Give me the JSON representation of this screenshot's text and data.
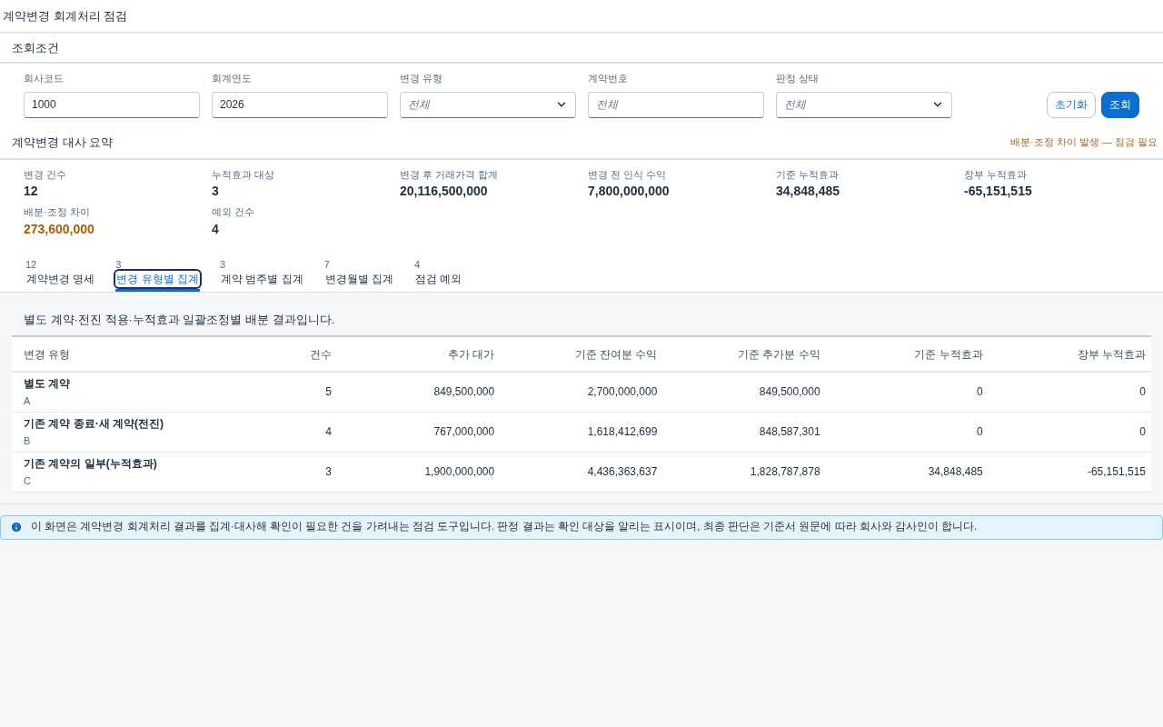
{
  "page_title": "계약변경 회계처리 점검",
  "filter": {
    "title": "조회조건",
    "fields": [
      {
        "label": "회사코드",
        "kind": "input",
        "value": "1000"
      },
      {
        "label": "회계연도",
        "kind": "input",
        "value": "2026"
      },
      {
        "label": "변경 유형",
        "kind": "select",
        "placeholder": "전체"
      },
      {
        "label": "계약번호",
        "kind": "input",
        "placeholder": "전체"
      },
      {
        "label": "판정 상태",
        "kind": "select",
        "placeholder": "전체"
      }
    ],
    "buttons": [
      {
        "label": "초기화",
        "kind": "secondary"
      },
      {
        "label": "조회",
        "kind": "primary"
      }
    ]
  },
  "summary": {
    "title": "계약변경 대사 요약",
    "alert": "배분·조정 차이 발생 — 점검 필요",
    "kpis": [
      {
        "label": "변경 건수",
        "value": "12",
        "kind": "normal"
      },
      {
        "label": "누적효과 대상",
        "value": "3",
        "kind": "normal"
      },
      {
        "label": "변경 후 거래가격 합계",
        "value": "20,116,500,000",
        "kind": "normal"
      },
      {
        "label": "변경 전 인식 수익",
        "value": "7,800,000,000",
        "kind": "normal"
      },
      {
        "label": "기준 누적효과",
        "value": "34,848,485",
        "kind": "normal"
      },
      {
        "label": "장부 누적효과",
        "value": "-65,151,515",
        "kind": "normal"
      },
      {
        "label": "배분·조정 차이",
        "value": "273,600,000",
        "kind": "warning"
      },
      {
        "label": "예외 건수",
        "value": "4",
        "kind": "normal"
      }
    ]
  },
  "tabs": [
    {
      "count": "12",
      "label": "계약변경 명세",
      "selected": false
    },
    {
      "count": "3",
      "label": "변경 유형별 집계",
      "selected": true
    },
    {
      "count": "3",
      "label": "계약 범주별 집계",
      "selected": false
    },
    {
      "count": "7",
      "label": "변경월별 집계",
      "selected": false
    },
    {
      "count": "4",
      "label": "점검 예외",
      "selected": false
    }
  ],
  "table": {
    "caption": "별도 계약·전진 적용·누적효과 일괄조정별 배분 결과입니다.",
    "columns": [
      "변경 유형",
      "건수",
      "추가 대가",
      "기준 잔여분 수익",
      "기준 추가분 수익",
      "기준 누적효과",
      "장부 누적효과"
    ],
    "rows": [
      {
        "code": "A",
        "cells": [
          "별도 계약",
          "5",
          "849,500,000",
          "2,700,000,000",
          "849,500,000",
          "0",
          "0"
        ]
      },
      {
        "code": "B",
        "cells": [
          "기존 계약 종료·새 계약(전진)",
          "4",
          "767,000,000",
          "1,618,412,699",
          "848,587,301",
          "0",
          "0"
        ]
      },
      {
        "code": "C",
        "cells": [
          "기존 계약의 일부(누적효과)",
          "3",
          "1,900,000,000",
          "4,436,363,637",
          "1,828,787,878",
          "34,848,485",
          "-65,151,515"
        ]
      }
    ]
  },
  "info_strip": "이 화면은 계약변경 회계처리 결과를 집계·대사해 확인이 필요한 건을 가려내는 점검 도구입니다. 판정 결과는 확인 대상을 알리는 표시이며, 최종 판단은 기준서 원문에 따라 회사와 감사인이 합니다."
}
